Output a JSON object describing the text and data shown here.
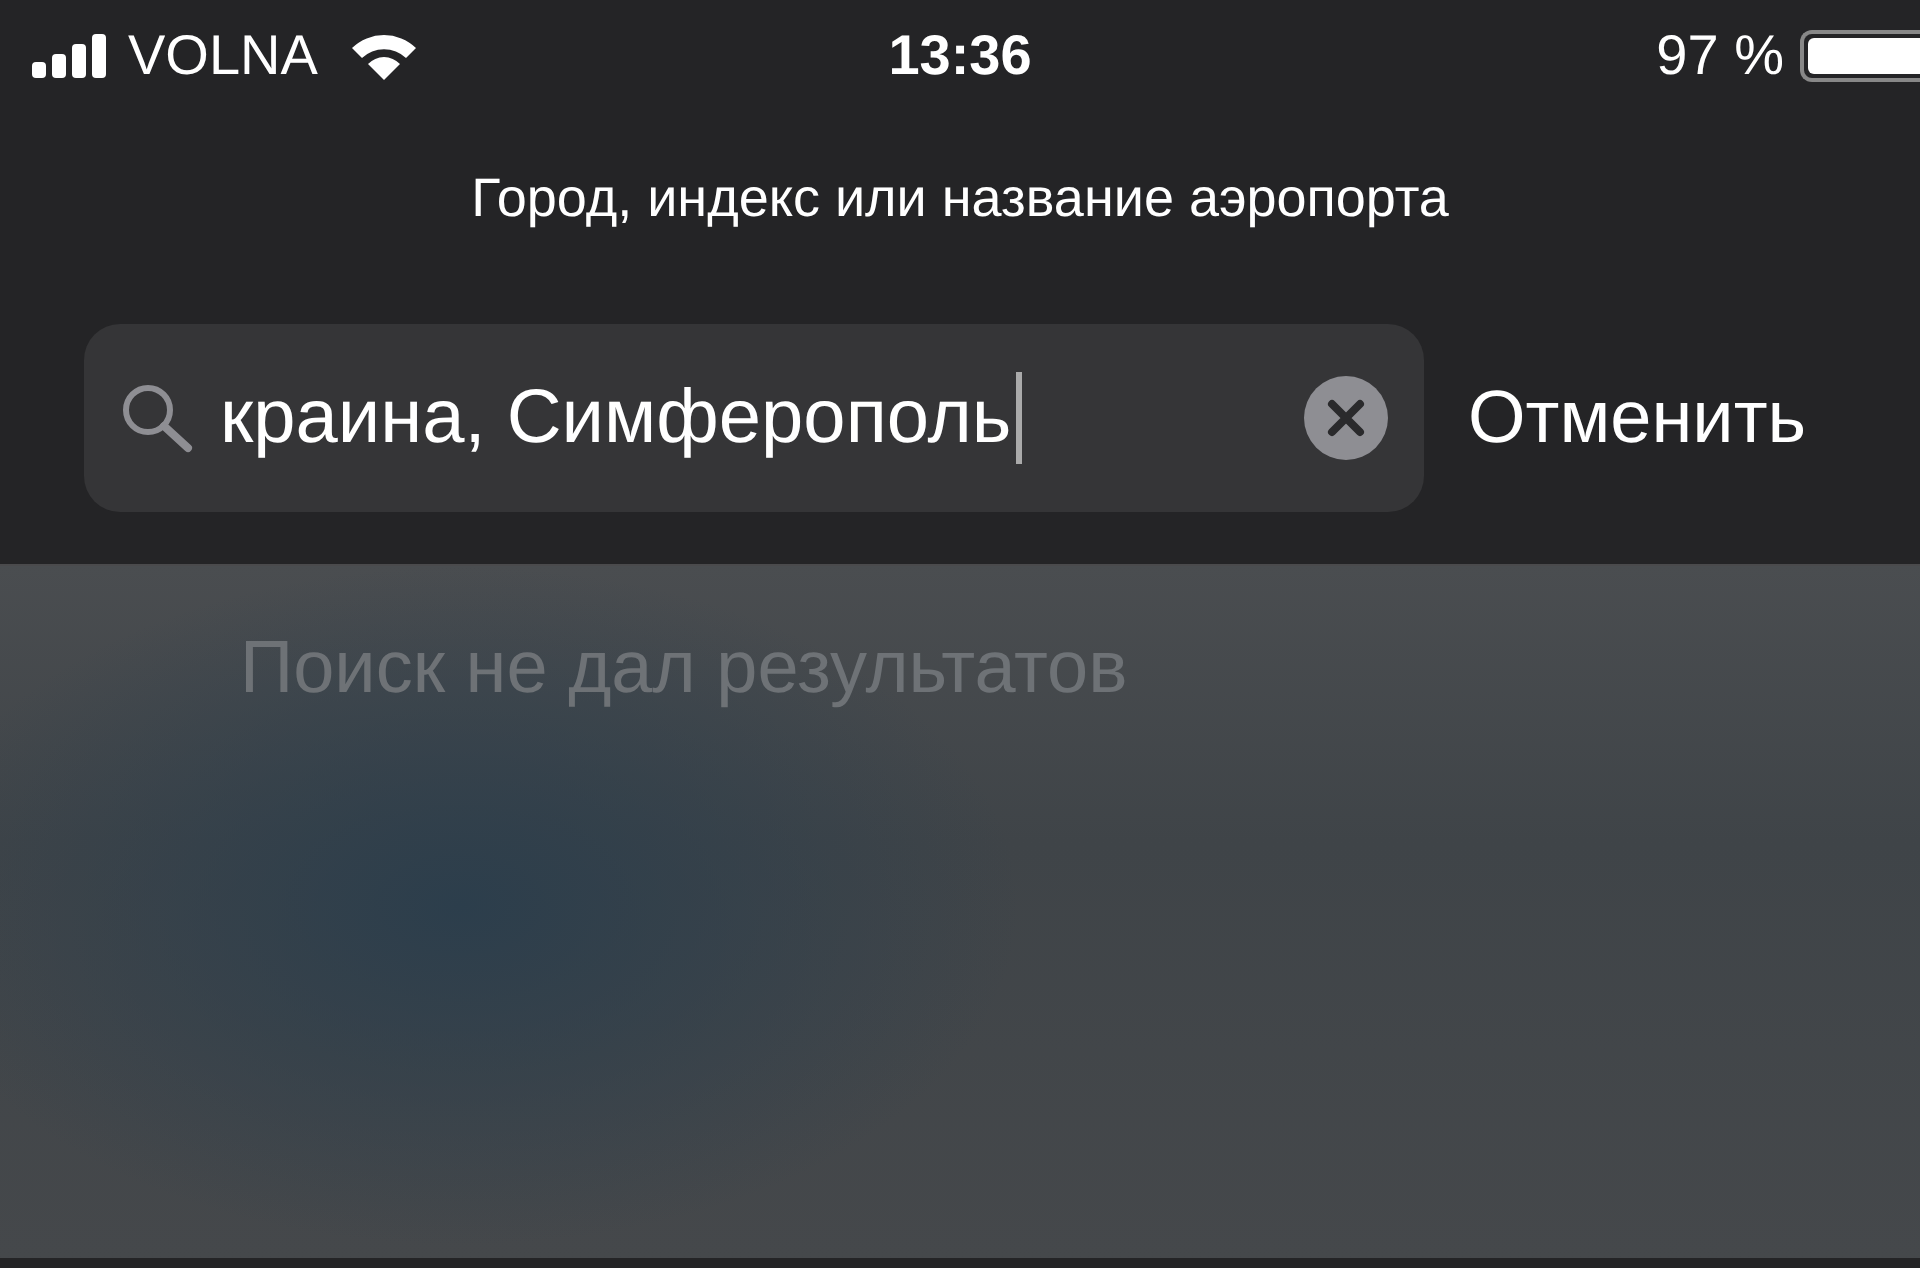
{
  "status_bar": {
    "carrier": "VOLNA",
    "time": "13:36",
    "battery": "97 %"
  },
  "search": {
    "hint": "Город, индекс или название аэропорта",
    "value": "краина, Симферополь",
    "cancel": "Отменить"
  },
  "results": {
    "message": "Поиск не дал результатов"
  }
}
